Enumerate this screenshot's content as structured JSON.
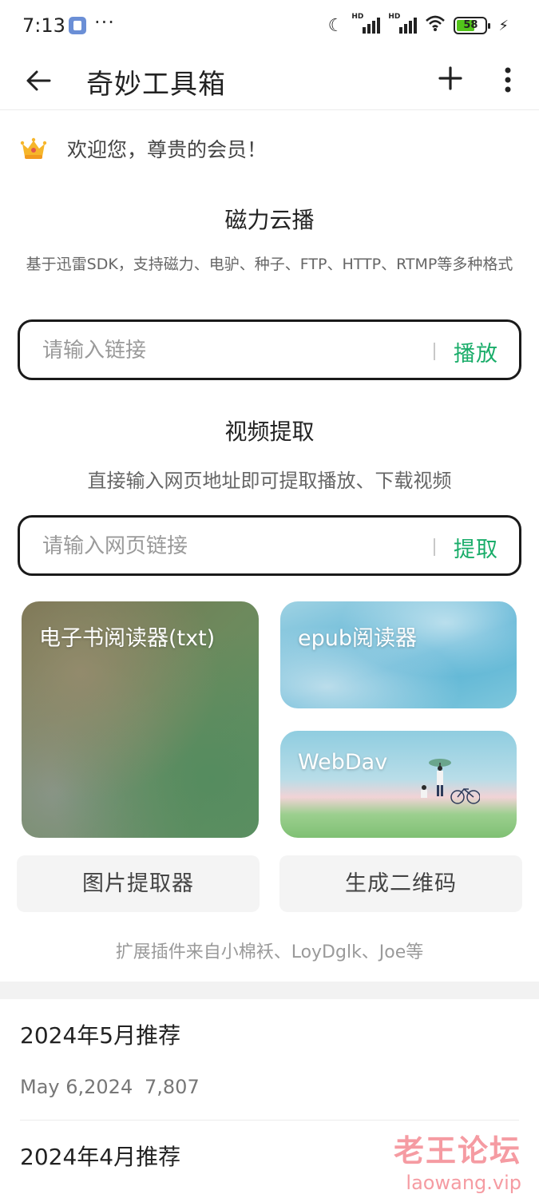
{
  "status_bar": {
    "time": "7:13",
    "dots": "···",
    "battery": "58",
    "signal_label": "HD"
  },
  "app_bar": {
    "title": "奇妙工具箱"
  },
  "welcome": {
    "text": "欢迎您，尊贵的会员！"
  },
  "magnet": {
    "title": "磁力云播",
    "description": "基于迅雷SDK，支持磁力、电驴、种子、FTP、HTTP、RTMP等多种格式",
    "placeholder": "请输入链接",
    "action": "播放"
  },
  "video": {
    "title": "视频提取",
    "description": "直接输入网页地址即可提取播放、下载视频",
    "placeholder": "请输入网页链接",
    "action": "提取"
  },
  "cards": {
    "txt_reader": "电子书阅读器(txt)",
    "epub_reader": "epub阅读器",
    "webdav": "WebDav"
  },
  "buttons": {
    "image_extractor": "图片提取器",
    "qr_generator": "生成二维码"
  },
  "credits": "扩展插件来自小棉袄、LoyDglk、Joe等",
  "articles": [
    {
      "title": "2024年5月推荐",
      "date": "May 6,2024",
      "views": "7,807"
    },
    {
      "title": "2024年4月推荐"
    }
  ],
  "watermark": {
    "name": "老王论坛",
    "domain": "laowang.vip"
  },
  "colors": {
    "accent": "#1aad6a",
    "watermark": "#f48a92"
  }
}
